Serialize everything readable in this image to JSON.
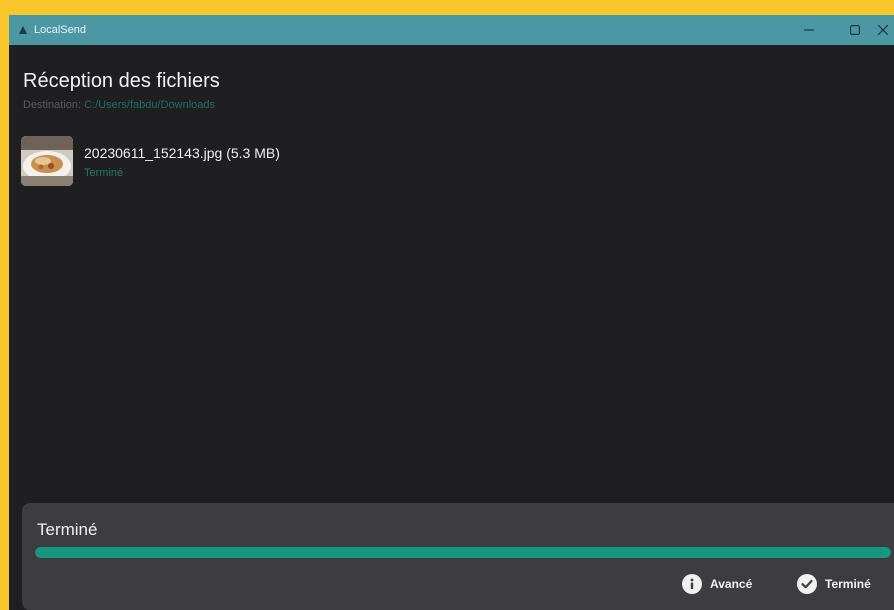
{
  "window": {
    "title": "LocalSend",
    "controls": {
      "minimize": "–",
      "maximize": "☐",
      "close": "✕"
    }
  },
  "page": {
    "heading": "Réception des fichiers",
    "destination_label": "Destination:",
    "destination_path": "C:/Users/fabdu/Downloads"
  },
  "files": [
    {
      "name": "20230611_152143.jpg (5.3 MB)",
      "status": "Terminé",
      "thumbnail_icon": "food-photo-thumbnail"
    }
  ],
  "footer": {
    "title": "Terminé",
    "progress": 1.0,
    "advanced_label": "Avancé",
    "advanced_icon": "info-icon",
    "done_label": "Terminé",
    "done_icon": "check-circle-icon"
  },
  "colors": {
    "accent": "#179682",
    "titlebar": "#4b98a4",
    "background": "#1f1f21"
  }
}
